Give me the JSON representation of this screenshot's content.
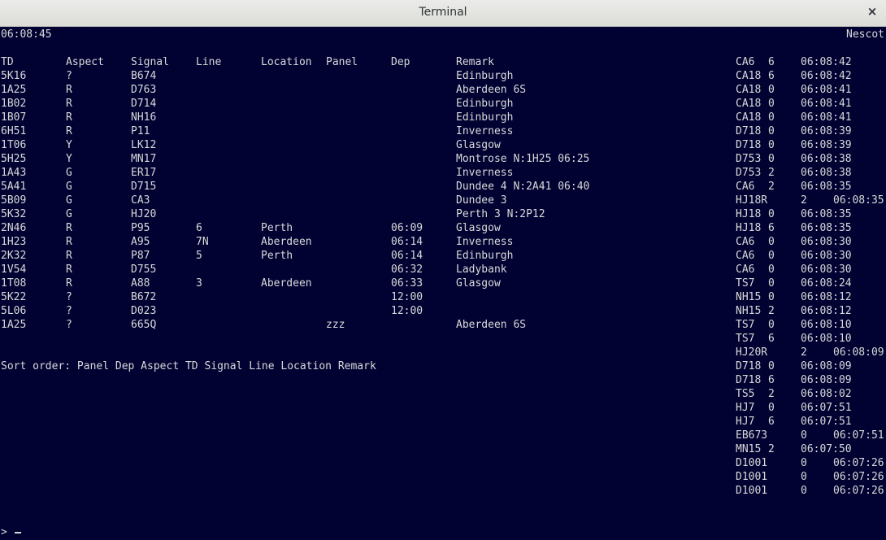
{
  "window": {
    "title": "Terminal",
    "close_glyph": "×"
  },
  "terminal": {
    "clock": "06:08:45",
    "location_name": "Nescot",
    "headers": [
      "TD",
      "Aspect",
      "Signal",
      "Line",
      "Location",
      "Panel",
      "Dep",
      "Remark"
    ],
    "rows": [
      [
        "5K16",
        "?",
        "B674",
        "",
        "",
        "",
        "",
        "Edinburgh"
      ],
      [
        "1A25",
        "R",
        "D763",
        "",
        "",
        "",
        "",
        "Aberdeen 6S"
      ],
      [
        "1B02",
        "R",
        "D714",
        "",
        "",
        "",
        "",
        "Edinburgh"
      ],
      [
        "1B07",
        "R",
        "NH16",
        "",
        "",
        "",
        "",
        "Edinburgh"
      ],
      [
        "6H51",
        "R",
        "P11",
        "",
        "",
        "",
        "",
        "Inverness"
      ],
      [
        "1T06",
        "Y",
        "LK12",
        "",
        "",
        "",
        "",
        "Glasgow"
      ],
      [
        "5H25",
        "Y",
        "MN17",
        "",
        "",
        "",
        "",
        "Montrose N:1H25 06:25"
      ],
      [
        "1A43",
        "G",
        "ER17",
        "",
        "",
        "",
        "",
        "Inverness"
      ],
      [
        "5A41",
        "G",
        "D715",
        "",
        "",
        "",
        "",
        "Dundee 4 N:2A41 06:40"
      ],
      [
        "5B09",
        "G",
        "CA3",
        "",
        "",
        "",
        "",
        "Dundee 3"
      ],
      [
        "5K32",
        "G",
        "HJ20",
        "",
        "",
        "",
        "",
        "Perth 3 N:2P12"
      ],
      [
        "2N46",
        "R",
        "P95",
        "6",
        "Perth",
        "",
        "06:09",
        "Glasgow"
      ],
      [
        "1H23",
        "R",
        "A95",
        "7N",
        "Aberdeen",
        "",
        "06:14",
        "Inverness"
      ],
      [
        "2K32",
        "R",
        "P87",
        "5",
        "Perth",
        "",
        "06:14",
        "Edinburgh"
      ],
      [
        "1V54",
        "R",
        "D755",
        "",
        "",
        "",
        "06:32",
        "Ladybank"
      ],
      [
        "1T08",
        "R",
        "A88",
        "3",
        "Aberdeen",
        "",
        "06:33",
        "Glasgow"
      ],
      [
        "5K22",
        "?",
        "B672",
        "",
        "",
        "",
        "12:00",
        ""
      ],
      [
        "5L06",
        "?",
        "D023",
        "",
        "",
        "",
        "12:00",
        ""
      ],
      [
        "1A25",
        "?",
        "665Q",
        "",
        "",
        "zzz",
        "",
        "Aberdeen 6S"
      ]
    ],
    "sort_order": "Sort order: Panel Dep Aspect TD Signal Line Location Remark",
    "log": [
      [
        "CA6",
        "6",
        "06:08:42"
      ],
      [
        "CA18",
        "6",
        "06:08:42"
      ],
      [
        "CA18",
        "0",
        "06:08:41"
      ],
      [
        "CA18",
        "0",
        "06:08:41"
      ],
      [
        "CA18",
        "0",
        "06:08:41"
      ],
      [
        "D718",
        "0",
        "06:08:39"
      ],
      [
        "D718",
        "0",
        "06:08:39"
      ],
      [
        "D753",
        "0",
        "06:08:38"
      ],
      [
        "D753",
        "2",
        "06:08:38"
      ],
      [
        "CA6",
        "2",
        "06:08:35"
      ],
      [
        "HJ18R",
        "2",
        "06:08:35"
      ],
      [
        "HJ18",
        "0",
        "06:08:35"
      ],
      [
        "HJ18",
        "6",
        "06:08:35"
      ],
      [
        "CA6",
        "0",
        "06:08:30"
      ],
      [
        "CA6",
        "0",
        "06:08:30"
      ],
      [
        "CA6",
        "0",
        "06:08:30"
      ],
      [
        "TS7",
        "0",
        "06:08:24"
      ],
      [
        "NH15",
        "0",
        "06:08:12"
      ],
      [
        "NH15",
        "2",
        "06:08:12"
      ],
      [
        "TS7",
        "0",
        "06:08:10"
      ],
      [
        "TS7",
        "6",
        "06:08:10"
      ],
      [
        "HJ20R",
        "2",
        "06:08:09"
      ],
      [
        "D718",
        "0",
        "06:08:09"
      ],
      [
        "D718",
        "6",
        "06:08:09"
      ],
      [
        "TS5",
        "2",
        "06:08:02"
      ],
      [
        "HJ7",
        "0",
        "06:07:51"
      ],
      [
        "HJ7",
        "6",
        "06:07:51"
      ],
      [
        "EB673",
        "0",
        "06:07:51"
      ],
      [
        "MN15",
        "2",
        "06:07:50"
      ],
      [
        "D1001",
        "0",
        "06:07:26"
      ],
      [
        "D1001",
        "0",
        "06:07:26"
      ],
      [
        "D1001",
        "0",
        "06:07:26"
      ]
    ],
    "prompt": ">"
  },
  "colors": {
    "background": "#010232",
    "text": "#d9d9d9"
  }
}
